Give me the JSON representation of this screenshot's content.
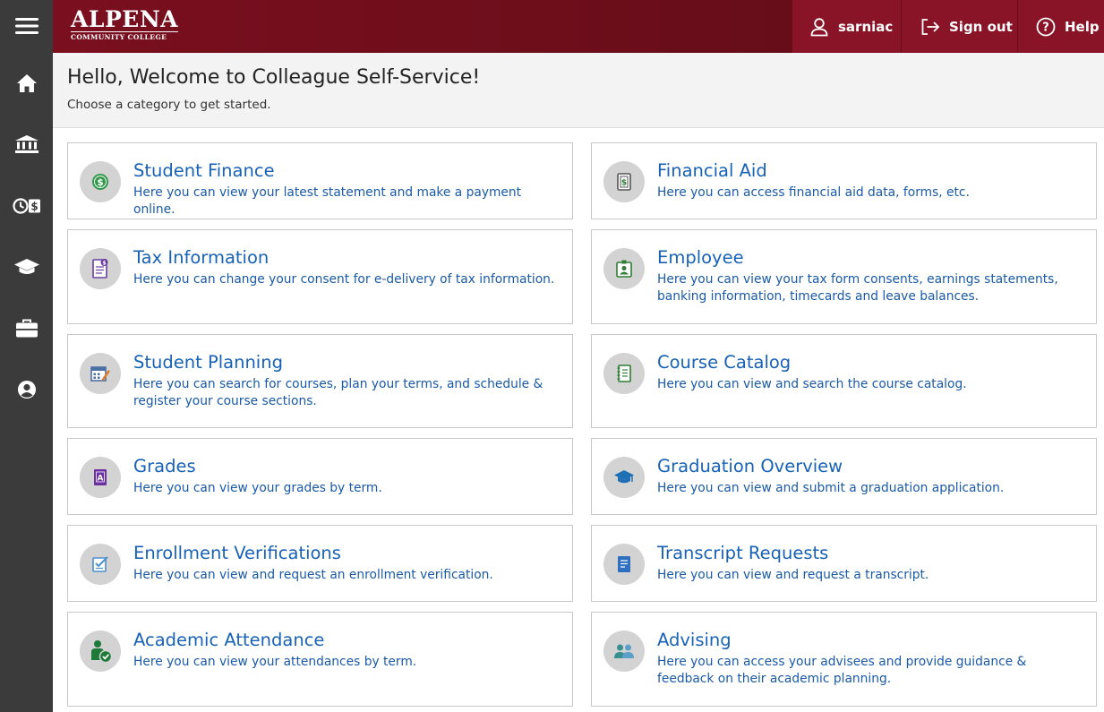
{
  "header": {
    "logo_main": "ALPENA",
    "logo_sub": "COMMUNITY COLLEGE",
    "user_label": "sarniac",
    "signout_label": "Sign out",
    "help_label": "Help"
  },
  "nav": {
    "items": [
      {
        "name": "menu-icon"
      },
      {
        "name": "home-icon"
      },
      {
        "name": "bank-icon"
      },
      {
        "name": "clock-dollar-icon"
      },
      {
        "name": "graduation-cap-icon"
      },
      {
        "name": "briefcase-icon"
      },
      {
        "name": "user-circle-icon"
      }
    ]
  },
  "welcome": {
    "title": "Hello, Welcome to Colleague Self-Service!",
    "subtitle": "Choose a category to get started."
  },
  "tiles": [
    {
      "title": "Student Finance",
      "desc": "Here you can view your latest statement and make a payment online.",
      "icon": "dollar-coin-icon",
      "color": "#2e9a47"
    },
    {
      "title": "Financial Aid",
      "desc": "Here you can access financial aid data, forms, etc.",
      "icon": "dollar-document-icon",
      "color": "#555555"
    },
    {
      "title": "Tax Information",
      "desc": "Here you can change your consent for e-delivery of tax information.",
      "icon": "tax-document-icon",
      "color": "#6a3fa0"
    },
    {
      "title": "Employee",
      "desc": "Here you can view your tax form consents, earnings statements, banking information, timecards and leave balances.",
      "icon": "id-badge-icon",
      "color": "#2e7d32"
    },
    {
      "title": "Student Planning",
      "desc": "Here you can search for courses, plan your terms, and schedule & register your course sections.",
      "icon": "calendar-pencil-icon",
      "color": "#4a6fa5"
    },
    {
      "title": "Course Catalog",
      "desc": "Here you can view and search the course catalog.",
      "icon": "catalog-book-icon",
      "color": "#2e7d32"
    },
    {
      "title": "Grades",
      "desc": "Here you can view your grades by term.",
      "icon": "grade-a-icon",
      "color": "#6a2fa0"
    },
    {
      "title": "Graduation Overview",
      "desc": "Here you can view and submit a graduation application.",
      "icon": "graduation-cap-icon",
      "color": "#1f6fb5"
    },
    {
      "title": "Enrollment Verifications",
      "desc": "Here you can view and request an enrollment verification.",
      "icon": "checklist-icon",
      "color": "#4a8fd0"
    },
    {
      "title": "Transcript Requests",
      "desc": "Here you can view and request a transcript.",
      "icon": "transcript-icon",
      "color": "#2f6fc0"
    },
    {
      "title": "Academic Attendance",
      "desc": "Here you can view your attendances by term.",
      "icon": "person-check-icon",
      "color": "#1f7a3a"
    },
    {
      "title": "Advising",
      "desc": "Here you can access your advisees and provide guidance & feedback on their academic planning.",
      "icon": "people-icon",
      "color": "#3a8f8f"
    }
  ]
}
